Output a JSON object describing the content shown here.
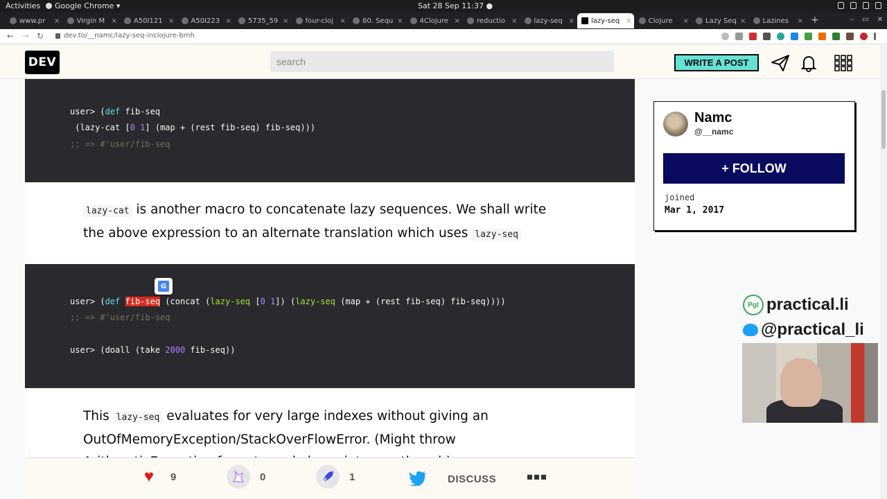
{
  "os": {
    "activities": "Activities",
    "app_name": "Google Chrome ▾",
    "clock": "Sat 28 Sep  11:37 ●"
  },
  "tabs": [
    {
      "label": "www.pr",
      "active": false
    },
    {
      "label": "Virgin M",
      "active": false
    },
    {
      "label": "A50I121",
      "active": false
    },
    {
      "label": "A50I223",
      "active": false
    },
    {
      "label": "5735_59",
      "active": false
    },
    {
      "label": "four-cloj",
      "active": false
    },
    {
      "label": "60. Sequ",
      "active": false
    },
    {
      "label": "4Clojure",
      "active": false
    },
    {
      "label": "reductio",
      "active": false
    },
    {
      "label": "lazy-seq",
      "active": false
    },
    {
      "label": "lazy-seq",
      "active": true
    },
    {
      "label": "Clojure",
      "active": false
    },
    {
      "label": "Lazy Seq",
      "active": false
    },
    {
      "label": "Lazines",
      "active": false
    }
  ],
  "browser": {
    "url": "dev.to/__namc/lazy-seq-inclojure-bmh",
    "new_tab": "+",
    "window_controls": [
      "–",
      "▭",
      "✕"
    ]
  },
  "header": {
    "logo": "DEV",
    "search_placeholder": "search",
    "write_post": "WRITE A POST"
  },
  "article": {
    "code1": {
      "line1_prefix": "user> (",
      "line1_kw": "def",
      "line1_rest": " fib-seq",
      "line2_a": " (lazy-cat [",
      "line2_n0": "0",
      "line2_sp": " ",
      "line2_n1": "1",
      "line2_b": "] (map + (rest fib-seq) fib-seq)))",
      "line3": ";; => #'user/fib-seq"
    },
    "para1": {
      "code": "lazy-cat",
      "text_a": " is another macro to concatenate lazy sequences. We shall write the above expression to an alternate translation which uses ",
      "code2": "lazy-seq"
    },
    "code2": {
      "l1_a": "user> (",
      "l1_kw": "def",
      "l1_sp": " ",
      "l1_hl": "fib-seq",
      "l1_b": " (concat (",
      "l1_fn1": "lazy-seq",
      "l1_c": " [",
      "l1_n0": "0",
      "l1_sp2": " ",
      "l1_n1": "1",
      "l1_d": "]) (",
      "l1_fn2": "lazy-seq",
      "l1_e": " (map + (rest fib-seq) fib-seq))))",
      "l2": ";; => #'user/fib-seq",
      "l3_a": "user> (doall (take ",
      "l3_num": "2000",
      "l3_b": " fib-seq))"
    },
    "para2": {
      "text_a": "This ",
      "code": "lazy-seq",
      "text_b": " evaluates for very large indexes without giving an OutOfMemoryException/StackOverFlowError. (Might throw ArithmeticException for extremely large integers though)."
    }
  },
  "reactions": {
    "heart_count": "9",
    "unicorn_count": "0",
    "bookmark_count": "1",
    "discuss": "DISCUSS"
  },
  "sidebar": {
    "name": "Namc",
    "handle": "@__namc",
    "follow": "+ FOLLOW",
    "joined_label": "joined",
    "joined_date": "Mar 1, 2017"
  },
  "watermark": {
    "site": "practical.li",
    "pgi": "PɡI",
    "twitter": "@practical_li"
  },
  "colors": {
    "accent": "#66e2d5",
    "follow_bg": "#0a0a5e",
    "code_bg": "#29292e",
    "highlight": "#d52b1e"
  }
}
